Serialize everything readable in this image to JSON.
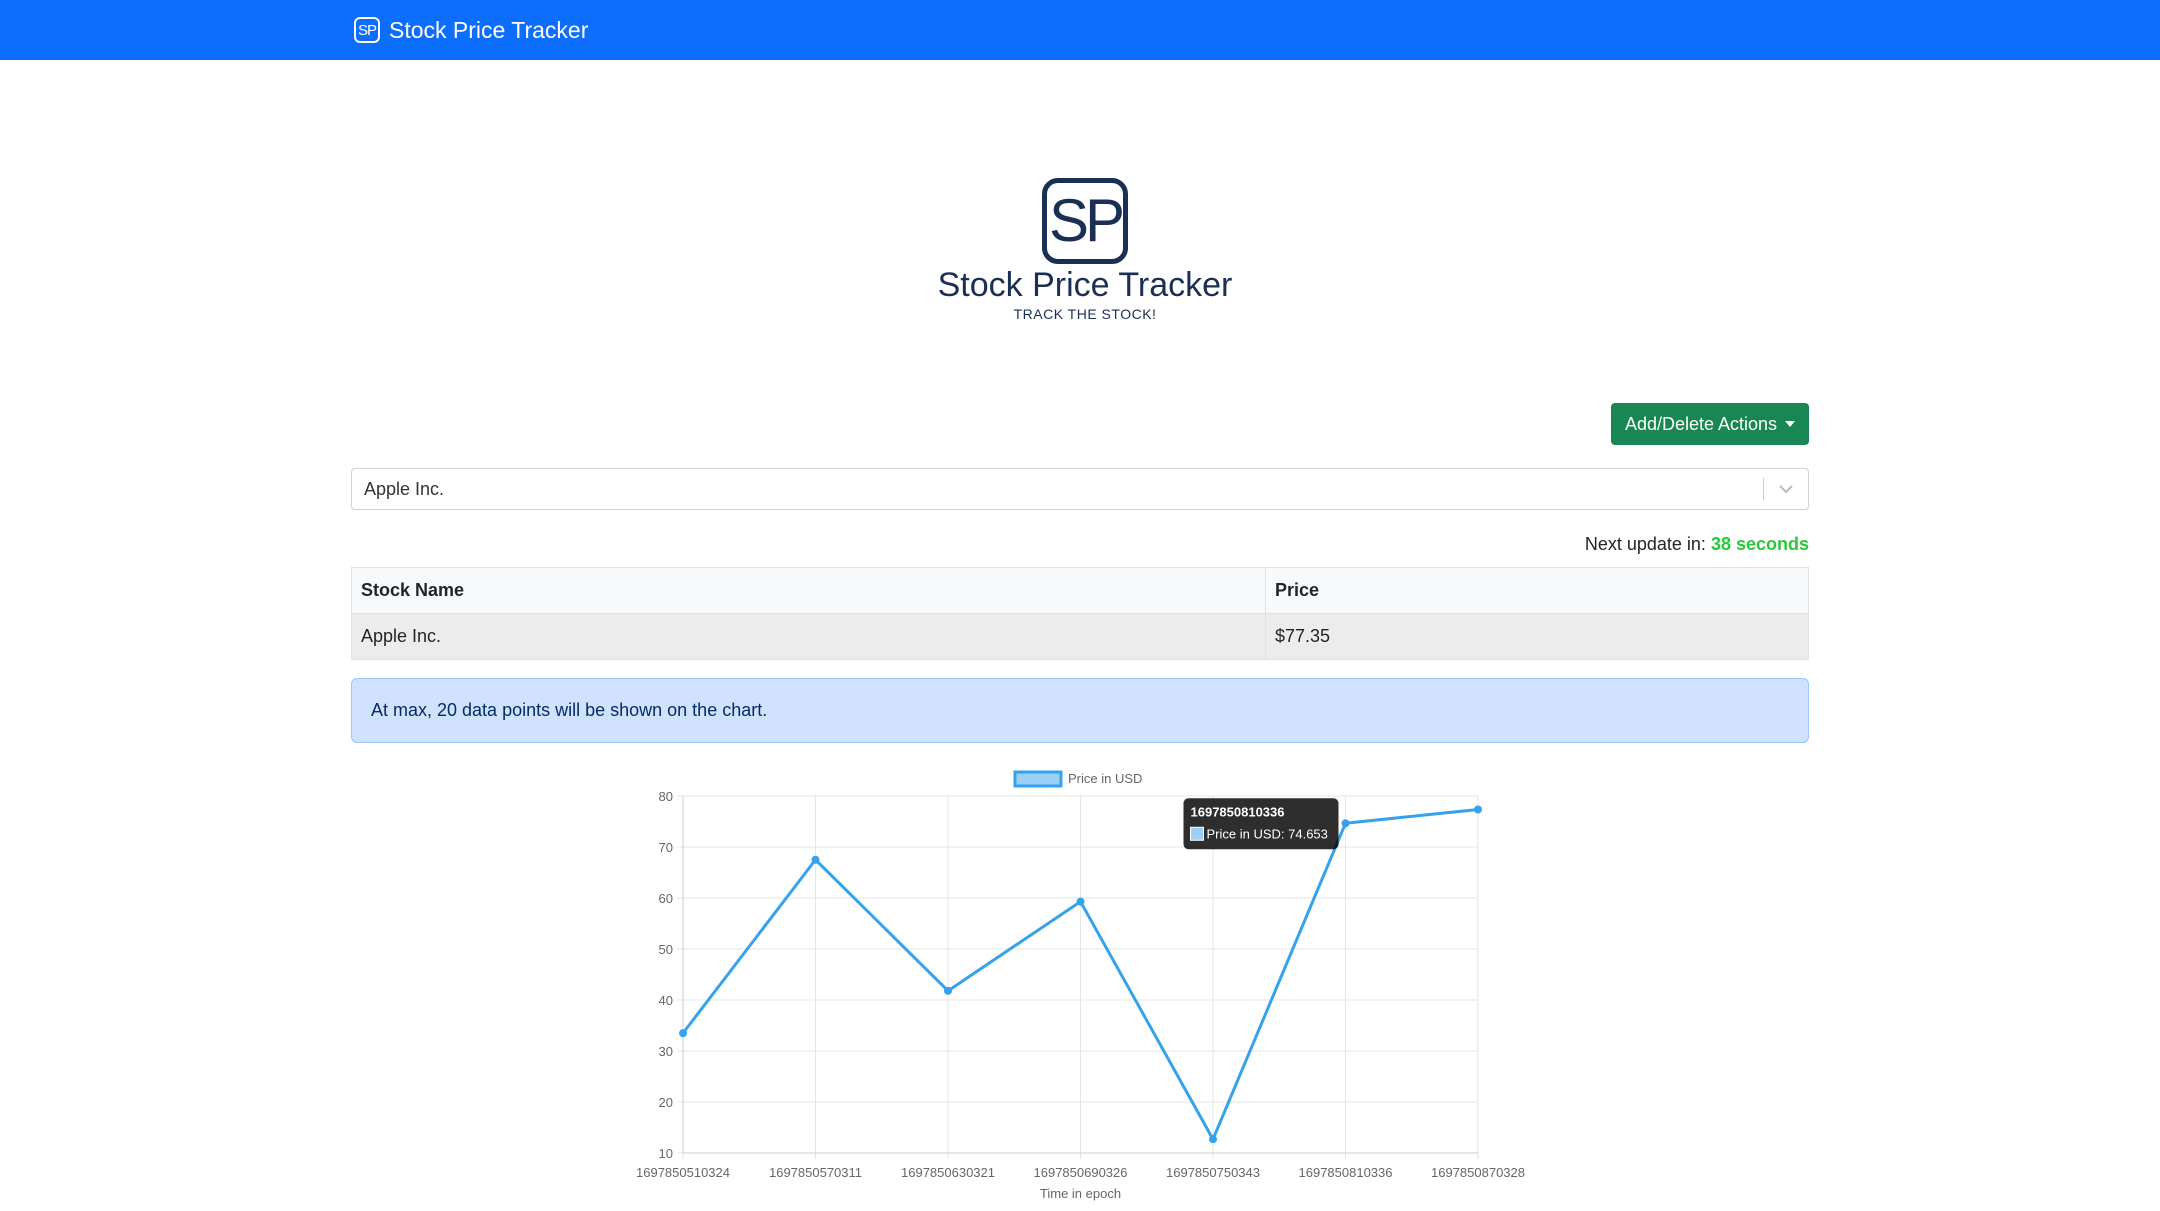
{
  "navbar": {
    "brand_icon": "SP",
    "brand_text": "Stock Price Tracker"
  },
  "logo": {
    "mark": "SP",
    "title": "Stock Price Tracker",
    "tagline": "TRACK THE STOCK!"
  },
  "actions_button": {
    "label": "Add/Delete Actions"
  },
  "stock_select": {
    "value": "Apple Inc."
  },
  "next_update": {
    "label": "Next update in:",
    "value": "38 seconds"
  },
  "table": {
    "headers": [
      "Stock Name",
      "Price"
    ],
    "rows": [
      [
        "Apple Inc.",
        "$77.35"
      ]
    ]
  },
  "alert": {
    "text": "At max, 20 data points will be shown on the chart."
  },
  "chart_data": {
    "type": "line",
    "x": [
      "1697850510324",
      "1697850570311",
      "1697850630321",
      "1697850690326",
      "1697850750343",
      "1697850810336",
      "1697850870328"
    ],
    "series": [
      {
        "name": "Price in USD",
        "values": [
          33.5,
          67.5,
          41.8,
          59.3,
          12.7,
          74.653,
          77.35
        ]
      }
    ],
    "xlabel": "Time in epoch",
    "ylabel": "",
    "ylim": [
      10,
      80
    ],
    "yticks": [
      10,
      20,
      30,
      40,
      50,
      60,
      70,
      80
    ],
    "grid": true,
    "legend": "top",
    "color": "#36a2eb",
    "tooltip": {
      "title": "1697850810336",
      "label": "Price in USD: 74.653"
    }
  }
}
